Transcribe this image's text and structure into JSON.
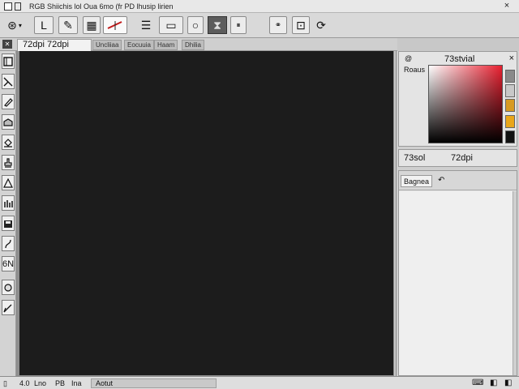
{
  "window": {
    "title": "RGB Shiichis lol  Oua 6mo (fr PD lhusip lirien",
    "close_glyph": "×"
  },
  "options_bar": {
    "mode_glyph": "⊛",
    "items": [
      {
        "name": "brush-tool-option",
        "glyph": "L"
      },
      {
        "name": "pen-tool-option",
        "glyph": "✎"
      },
      {
        "name": "grid-option",
        "glyph": "▦"
      },
      {
        "name": "line-preview-option",
        "glyph": "⟋"
      },
      {
        "name": "menu-option",
        "glyph": "☰"
      },
      {
        "name": "mask-option",
        "glyph": "▭"
      },
      {
        "name": "circle-option",
        "glyph": "○"
      },
      {
        "name": "hourglass-option",
        "glyph": "⧗"
      },
      {
        "name": "pause-option",
        "glyph": "⏸"
      },
      {
        "name": "link-option",
        "glyph": "⚭"
      },
      {
        "name": "target-option",
        "glyph": "⊡"
      },
      {
        "name": "refresh-option",
        "glyph": "⟳"
      }
    ]
  },
  "document": {
    "close_glyph": "✕",
    "active_tab": "72dpi   72dpi",
    "other_tabs": [
      "Uncliiaa",
      "Eocuuia",
      "Haam",
      "Dhilia"
    ]
  },
  "tools": [
    {
      "name": "frame-tool"
    },
    {
      "name": "line-tool"
    },
    {
      "name": "pen-tool"
    },
    {
      "name": "box-tool"
    },
    {
      "name": "bucket-tool"
    },
    {
      "name": "stamp-tool"
    },
    {
      "name": "shape-tool"
    },
    {
      "name": "bars-tool"
    },
    {
      "name": "save-tool"
    },
    {
      "name": "curve-tool"
    },
    {
      "name": "text-tool",
      "label": "6N"
    },
    {
      "name": "zoom-tool"
    },
    {
      "name": "pencil-tool"
    }
  ],
  "color_panel": {
    "small_label": "@",
    "title": "73stvial",
    "close_glyph": "×",
    "label": "Roaus",
    "swatches": [
      {
        "name": "gray-swatch",
        "color": "#8a8a8a"
      },
      {
        "name": "light-swatch",
        "color": "#c8c8c8"
      },
      {
        "name": "amber-swatch",
        "color": "#d79a22"
      },
      {
        "name": "gold-swatch",
        "color": "#e9a61a"
      },
      {
        "name": "black-swatch",
        "color": "#111111"
      }
    ],
    "colors": {
      "field_from": "#ffffff",
      "field_to": "#e82030"
    }
  },
  "resolution_panel": {
    "left": "73sol",
    "right": "72dpi"
  },
  "properties_panel": {
    "title": "Bagnea",
    "icon_glyph": "↶"
  },
  "status_bar": {
    "items": [
      "4.0",
      "Lno",
      "PB",
      "Ina",
      "Aotut"
    ],
    "right_glyph": "⌨",
    "right_controls": "◧"
  },
  "colors": {
    "canvas": "#1c1c1c",
    "chrome": "#d3d3d3"
  }
}
